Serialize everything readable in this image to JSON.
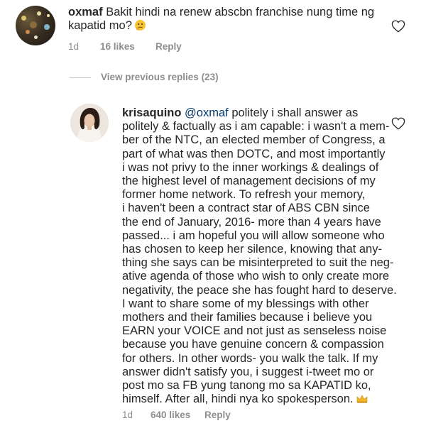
{
  "comment": {
    "username": "oxmaf",
    "text": "Bakit hindi na renew abscbn franchise nung time ng kapatid mo?",
    "emoji_icon": "thinking-face-icon",
    "time": "1d",
    "likes": "16 likes",
    "reply_label": "Reply"
  },
  "view_replies": "View previous replies (23)",
  "reply": {
    "username": "krisaquino",
    "mention": "@oxmaf",
    "lines": [
      "politely i shall answer as",
      "politely & factually as i am capable: i wasn't a mem-",
      "ber of the NTC, an elected member of Congress, a",
      "part of what was then DOTC, and most importantly",
      "i was not privy to the inner workings & dealings of",
      "the highest level of management decisions of my",
      "former home network. To refresh your memory,",
      "i haven't been a contract star of ABS CBN since",
      "the end of January, 2016- more than 4 years have",
      "passed... i am hopeful you will allow someone who",
      "has chosen to keep her silence, knowing that any-",
      "thing she says can be misinterpreted to suit the neg-",
      "ative agenda of those who wish to only create more",
      "negativity, the peace she has fought hard to deserve.",
      "I want to share some of my blessings with other",
      "mothers and their families because i believe you",
      "EARN your VOICE and not just as senseless noise",
      "because you have genuine concern & compassion",
      "for others. In other words- you walk the talk. If my",
      "answer didn't satisfy you, i suggest i-tweet mo or",
      "post mo sa FB yung tanong mo sa KAPATID ko,",
      "himself. After all, hindi nya ko spokesperson."
    ],
    "emoji_icon": "crown-icon",
    "time": "1d",
    "likes": "640 likes",
    "reply_label": "Reply"
  }
}
